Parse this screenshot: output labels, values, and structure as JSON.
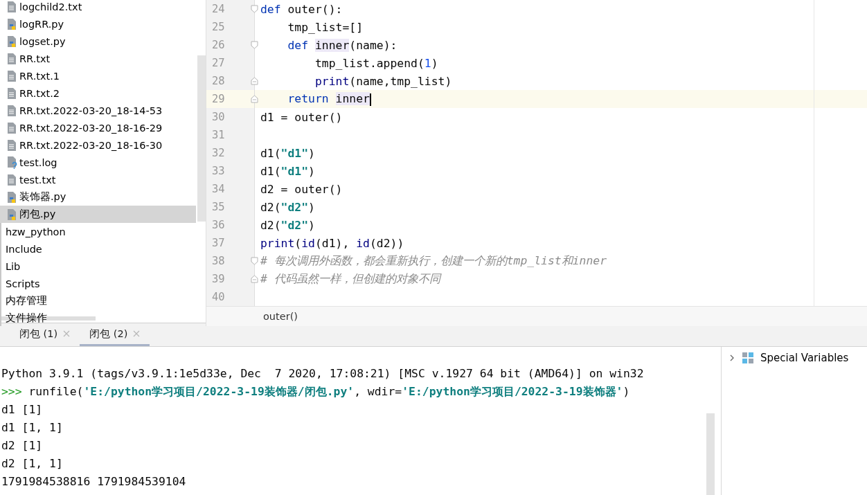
{
  "project_tree": {
    "items": [
      {
        "label": "logchild2.txt",
        "kind": "text",
        "selected": false
      },
      {
        "label": "logRR.py",
        "kind": "python",
        "selected": false
      },
      {
        "label": "logset.py",
        "kind": "python",
        "selected": false
      },
      {
        "label": "RR.txt",
        "kind": "text",
        "selected": false
      },
      {
        "label": "RR.txt.1",
        "kind": "text",
        "selected": false
      },
      {
        "label": "RR.txt.2",
        "kind": "text",
        "selected": false
      },
      {
        "label": "RR.txt.2022-03-20_18-14-53",
        "kind": "text",
        "selected": false
      },
      {
        "label": "RR.txt.2022-03-20_18-16-29",
        "kind": "text",
        "selected": false
      },
      {
        "label": "RR.txt.2022-03-20_18-16-30",
        "kind": "text",
        "selected": false
      },
      {
        "label": "test.log",
        "kind": "unknown",
        "selected": false
      },
      {
        "label": "test.txt",
        "kind": "text",
        "selected": false
      },
      {
        "label": "装饰器.py",
        "kind": "python",
        "selected": false
      },
      {
        "label": "闭包.py",
        "kind": "python",
        "selected": true
      },
      {
        "label": "hzw_python",
        "kind": "folder",
        "selected": false
      },
      {
        "label": "Include",
        "kind": "folder",
        "selected": false
      },
      {
        "label": "Lib",
        "kind": "folder",
        "selected": false
      },
      {
        "label": "Scripts",
        "kind": "folder",
        "selected": false
      },
      {
        "label": "内存管理",
        "kind": "folder",
        "selected": false
      },
      {
        "label": "文件操作",
        "kind": "folder",
        "selected": false
      }
    ]
  },
  "editor": {
    "lines": [
      {
        "number": "24",
        "current": false,
        "fold_start": true,
        "fold_end": false,
        "tokens": [
          {
            "text": "def ",
            "kind": "keyword"
          },
          {
            "text": "outer():",
            "kind": "plain"
          }
        ]
      },
      {
        "number": "25",
        "current": false,
        "fold_start": false,
        "fold_end": false,
        "tokens": [
          {
            "text": "    tmp_list=[]",
            "kind": "plain"
          }
        ]
      },
      {
        "number": "26",
        "current": false,
        "fold_start": true,
        "fold_end": false,
        "tokens": [
          {
            "text": "    def ",
            "kind": "keyword"
          },
          {
            "text": "inner",
            "kind": "usage"
          },
          {
            "text": "(name):",
            "kind": "plain"
          }
        ]
      },
      {
        "number": "27",
        "current": false,
        "fold_start": false,
        "fold_end": false,
        "tokens": [
          {
            "text": "        tmp_list.append(",
            "kind": "plain"
          },
          {
            "text": "1",
            "kind": "number"
          },
          {
            "text": ")",
            "kind": "plain"
          }
        ]
      },
      {
        "number": "28",
        "current": false,
        "fold_start": false,
        "fold_end": true,
        "tokens": [
          {
            "text": "        print",
            "kind": "builtin"
          },
          {
            "text": "(name,tmp_list)",
            "kind": "plain"
          }
        ]
      },
      {
        "number": "29",
        "current": true,
        "fold_start": false,
        "fold_end": true,
        "tokens": [
          {
            "text": "    return ",
            "kind": "keyword"
          },
          {
            "text": "inner",
            "kind": "usage"
          }
        ]
      },
      {
        "number": "30",
        "current": false,
        "fold_start": false,
        "fold_end": false,
        "tokens": [
          {
            "text": "d1 = outer()",
            "kind": "plain"
          }
        ]
      },
      {
        "number": "31",
        "current": false,
        "fold_start": false,
        "fold_end": false
      },
      {
        "number": "32",
        "current": false,
        "fold_start": false,
        "fold_end": false,
        "tokens": [
          {
            "text": "d1(",
            "kind": "plain"
          },
          {
            "text": "\"d1\"",
            "kind": "string"
          },
          {
            "text": ")",
            "kind": "plain"
          }
        ]
      },
      {
        "number": "33",
        "current": false,
        "fold_start": false,
        "fold_end": false,
        "tokens": [
          {
            "text": "d1(",
            "kind": "plain"
          },
          {
            "text": "\"d1\"",
            "kind": "string"
          },
          {
            "text": ")",
            "kind": "plain"
          }
        ]
      },
      {
        "number": "34",
        "current": false,
        "fold_start": false,
        "fold_end": false,
        "tokens": [
          {
            "text": "d2 = outer()",
            "kind": "plain"
          }
        ]
      },
      {
        "number": "35",
        "current": false,
        "fold_start": false,
        "fold_end": false,
        "tokens": [
          {
            "text": "d2(",
            "kind": "plain"
          },
          {
            "text": "\"d2\"",
            "kind": "string"
          },
          {
            "text": ")",
            "kind": "plain"
          }
        ]
      },
      {
        "number": "36",
        "current": false,
        "fold_start": false,
        "fold_end": false,
        "tokens": [
          {
            "text": "d2(",
            "kind": "plain"
          },
          {
            "text": "\"d2\"",
            "kind": "string"
          },
          {
            "text": ")",
            "kind": "plain"
          }
        ]
      },
      {
        "number": "37",
        "current": false,
        "fold_start": false,
        "fold_end": false,
        "tokens": [
          {
            "text": "print",
            "kind": "builtin"
          },
          {
            "text": "(",
            "kind": "plain"
          },
          {
            "text": "id",
            "kind": "builtin"
          },
          {
            "text": "(d1), ",
            "kind": "plain"
          },
          {
            "text": "id",
            "kind": "builtin"
          },
          {
            "text": "(d2))",
            "kind": "plain"
          }
        ]
      },
      {
        "number": "38",
        "current": false,
        "fold_start": true,
        "fold_end": false,
        "tokens": [
          {
            "text": "# 每次调用外函数，都会重新执行，创建一个新的tmp_list和inner",
            "kind": "comment"
          }
        ]
      },
      {
        "number": "39",
        "current": false,
        "fold_start": false,
        "fold_end": true,
        "tokens": [
          {
            "text": "# 代码虽然一样，但创建的对象不同",
            "kind": "comment"
          }
        ]
      },
      {
        "number": "40",
        "current": false,
        "fold_start": false,
        "fold_end": false
      }
    ],
    "breadcrumb": "outer()"
  },
  "console_tabs": [
    {
      "label": "闭包 (1)",
      "selected": false
    },
    {
      "label": "闭包 (2)",
      "selected": true
    }
  ],
  "console": {
    "lines": [
      [
        {
          "text": "Python 3.9.1 (tags/v3.9.1:1e5d33e, Dec  7 2020, 17:08:21) [MSC v.1927 64 bit (AMD64)] on win32",
          "kind": "plain"
        }
      ],
      [
        {
          "text": ">>>",
          "kind": "prompt"
        },
        {
          "text": " runfile(",
          "kind": "plain"
        },
        {
          "text": "'E:/python学习项目/2022-3-19装饰器/闭包.py'",
          "kind": "string"
        },
        {
          "text": ", wdir=",
          "kind": "plain"
        },
        {
          "text": "'E:/python学习项目/2022-3-19装饰器'",
          "kind": "string"
        },
        {
          "text": ")",
          "kind": "plain"
        }
      ],
      [
        {
          "text": "d1 [1]",
          "kind": "plain"
        }
      ],
      [
        {
          "text": "d1 [1, 1]",
          "kind": "plain"
        }
      ],
      [
        {
          "text": "d2 [1]",
          "kind": "plain"
        }
      ],
      [
        {
          "text": "d2 [1, 1]",
          "kind": "plain"
        }
      ],
      [
        {
          "text": "1791984538816 1791984539104",
          "kind": "plain"
        }
      ]
    ]
  },
  "variables": {
    "items": [
      {
        "label": "Special Variables",
        "expanded": false
      }
    ]
  }
}
